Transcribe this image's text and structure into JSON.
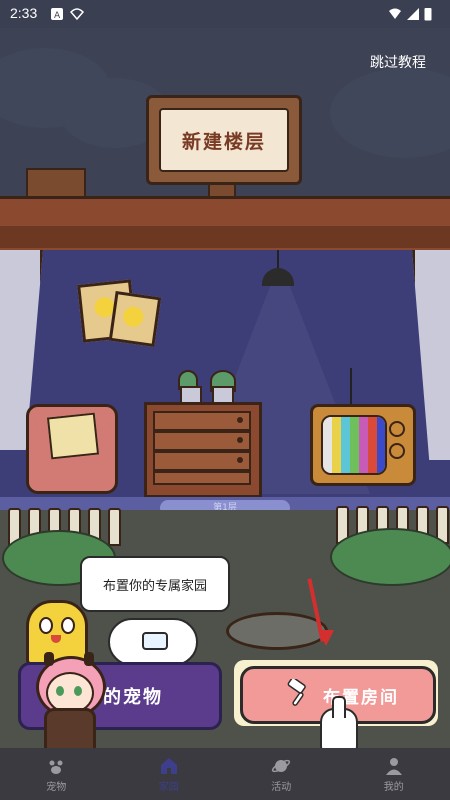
{
  "status_bar": {
    "time": "2:33"
  },
  "header": {
    "skip_tutorial": "跳过教程"
  },
  "sign": {
    "text": "新建楼层"
  },
  "room": {
    "floor_label": "第1层"
  },
  "bubble": {
    "text": "布置你的专属家园"
  },
  "buttons": {
    "my_pet": "我的宠物",
    "arrange_room": "布置房间"
  },
  "nav": {
    "items": [
      {
        "label": "宠物",
        "icon": "pet-icon",
        "active": false
      },
      {
        "label": "家园",
        "icon": "home-icon",
        "active": true
      },
      {
        "label": "活动",
        "icon": "planet-icon",
        "active": false
      },
      {
        "label": "我的",
        "icon": "profile-icon",
        "active": false
      }
    ]
  },
  "colors": {
    "accent": "#3d3f8c",
    "pet_button": "#5b3c8c",
    "room_button": "#f29a98"
  }
}
